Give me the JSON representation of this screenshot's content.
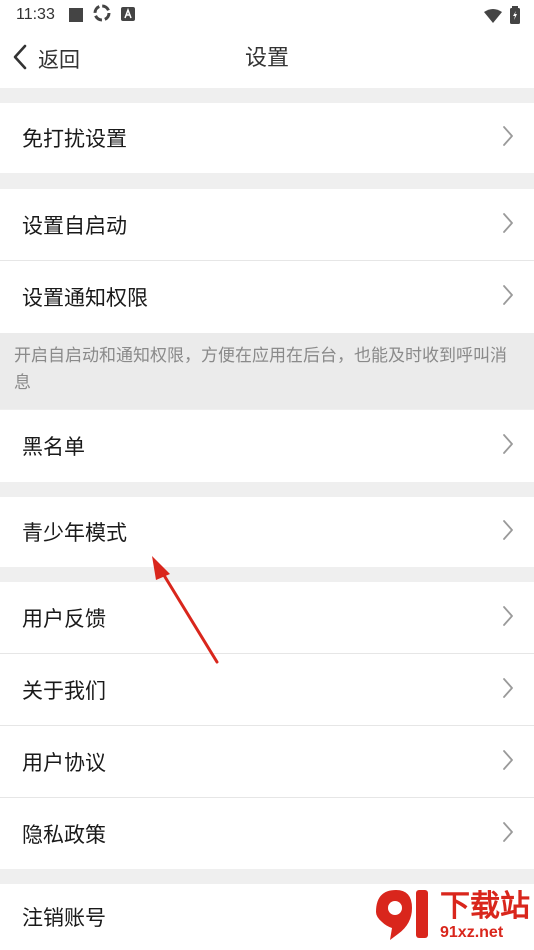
{
  "status_bar": {
    "time": "11:33"
  },
  "nav": {
    "back_label": "返回",
    "title": "设置"
  },
  "rows": [
    {
      "label": "免打扰设置"
    },
    {
      "label": "设置自启动"
    },
    {
      "label": "设置通知权限"
    },
    {
      "label": "黑名单"
    },
    {
      "label": "青少年模式"
    },
    {
      "label": "用户反馈"
    },
    {
      "label": "关于我们"
    },
    {
      "label": "用户协议"
    },
    {
      "label": "隐私政策"
    },
    {
      "label": "注销账号"
    }
  ],
  "note": {
    "text": "开启自启动和通知权限，方便在应用在后台，也能及时收到呼叫消息"
  },
  "watermark": {
    "name": "下载站",
    "url": "91xz.net"
  },
  "colors": {
    "accent": "#d9261c",
    "background": "#efefef",
    "text": "#1a1a1a",
    "muted": "#8a8a8a"
  }
}
